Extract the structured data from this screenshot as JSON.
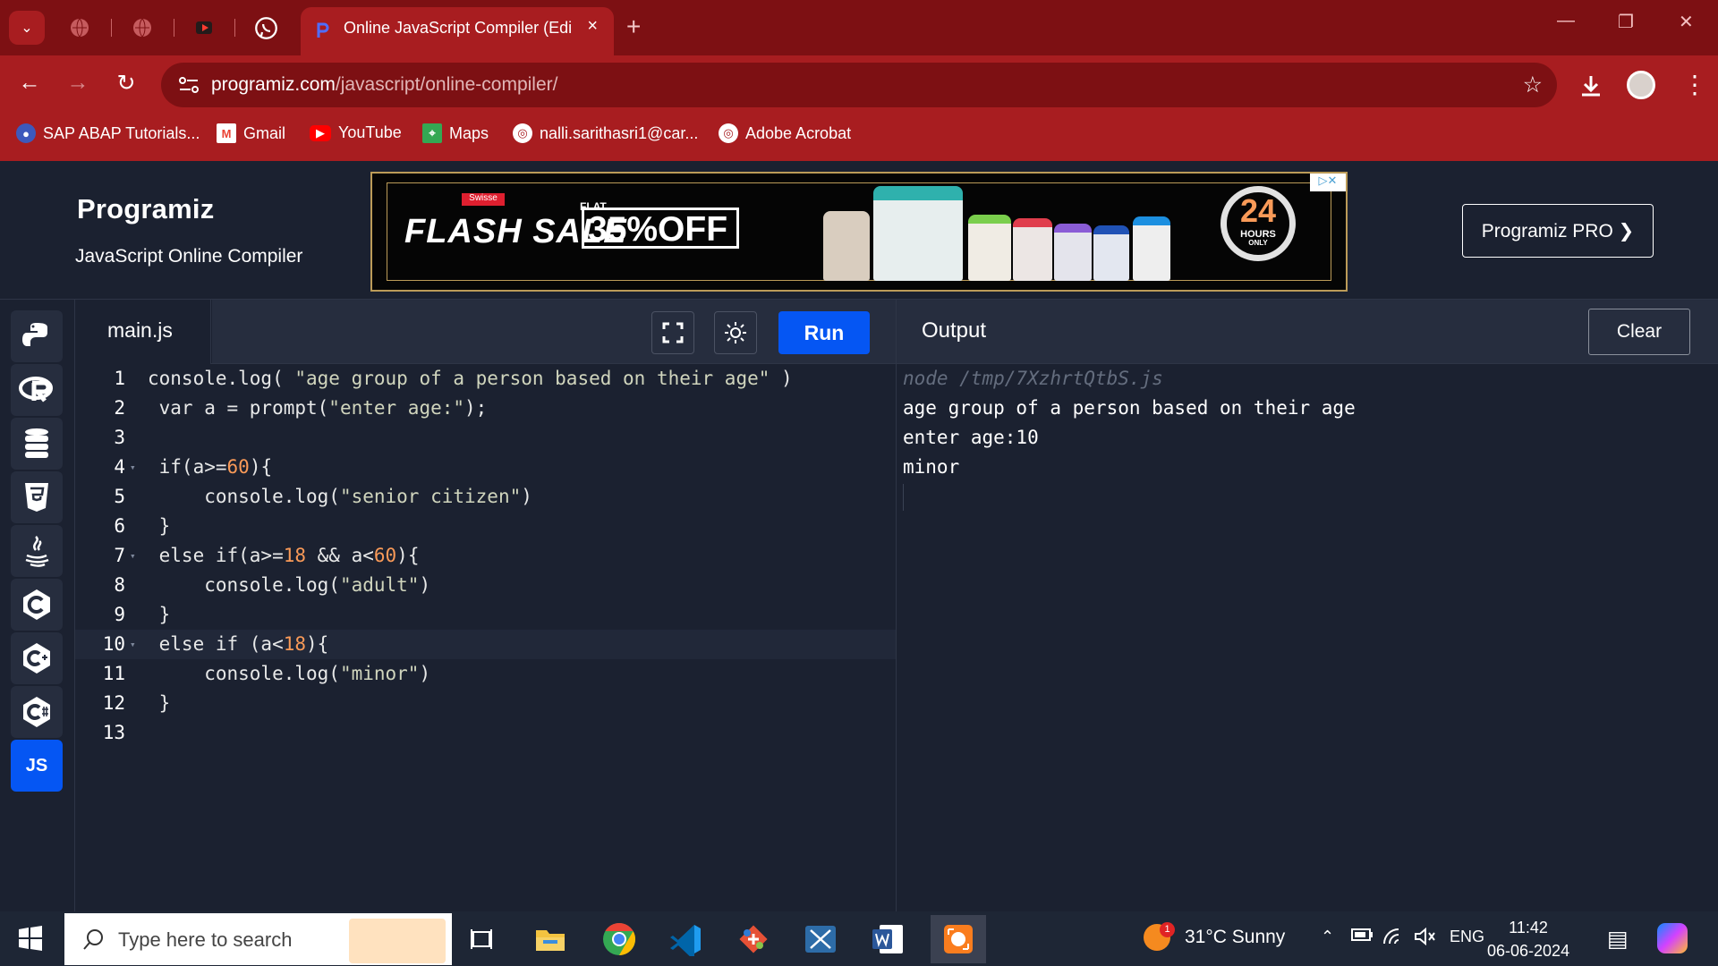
{
  "browser": {
    "tabs": [
      "Online JavaScript Compiler (Edi"
    ],
    "new_tab": "+",
    "close_tab": "×",
    "url_domain": "programiz.com",
    "url_path": "/javascript/online-compiler/",
    "bookmarks": [
      "SAP ABAP Tutorials...",
      "Gmail",
      "YouTube",
      "Maps",
      "nalli.sarithasri1@car...",
      "Adobe Acrobat"
    ]
  },
  "site": {
    "brand": "Programiz",
    "subtitle": "JavaScript Online Compiler",
    "pro_button": "Programiz PRO ❯",
    "ad": {
      "brand": "Swisse",
      "headline": "FLASH SALE",
      "flat": "FLAT",
      "discount": "35%OFF",
      "hours_number": "24",
      "hours_label": "HOURS",
      "only_label": "ONLY"
    }
  },
  "sidebar": {
    "languages": [
      "python",
      "r",
      "sql",
      "html",
      "java",
      "c",
      "cpp",
      "csharp",
      "javascript"
    ],
    "js_label": "JS"
  },
  "editor": {
    "file_name": "main.js",
    "run_label": "Run",
    "lines": [
      {
        "n": "1",
        "text": "console.log( \"age group of a person based on their age\" )",
        "active": false,
        "fold": ""
      },
      {
        "n": "2",
        "text": " var a = prompt(\"enter age:\");",
        "active": false,
        "fold": ""
      },
      {
        "n": "3",
        "text": "",
        "active": false,
        "fold": ""
      },
      {
        "n": "4",
        "text": " if(a>=60){",
        "active": false,
        "fold": "▾"
      },
      {
        "n": "5",
        "text": "     console.log(\"senior citizen\")",
        "active": false,
        "fold": ""
      },
      {
        "n": "6",
        "text": " }",
        "active": false,
        "fold": ""
      },
      {
        "n": "7",
        "text": " else if(a>=18 && a<60){",
        "active": false,
        "fold": "▾"
      },
      {
        "n": "8",
        "text": "     console.log(\"adult\")",
        "active": false,
        "fold": ""
      },
      {
        "n": "9",
        "text": " }",
        "active": false,
        "fold": ""
      },
      {
        "n": "10",
        "text": " else if (a<18){",
        "active": true,
        "fold": "▾"
      },
      {
        "n": "11",
        "text": "     console.log(\"minor\")",
        "active": false,
        "fold": ""
      },
      {
        "n": "12",
        "text": " }",
        "active": false,
        "fold": ""
      },
      {
        "n": "13",
        "text": "",
        "active": false,
        "fold": ""
      }
    ]
  },
  "output": {
    "title": "Output",
    "clear_label": "Clear",
    "lines": [
      "node /tmp/7XzhrtQtbS.js",
      "age group of a person based on their age",
      "enter age:10",
      "minor"
    ]
  },
  "taskbar": {
    "search_placeholder": "Type here to search",
    "weather_badge": "1",
    "weather": "31°C  Sunny",
    "language": "ENG",
    "time": "11:42",
    "date": "06-06-2024"
  },
  "colors": {
    "browser_red": "#a81d20",
    "tabstrip_red": "#7d1013",
    "background": "#1b2130",
    "run_blue": "#0556f3",
    "number_orange": "#f99a58"
  }
}
